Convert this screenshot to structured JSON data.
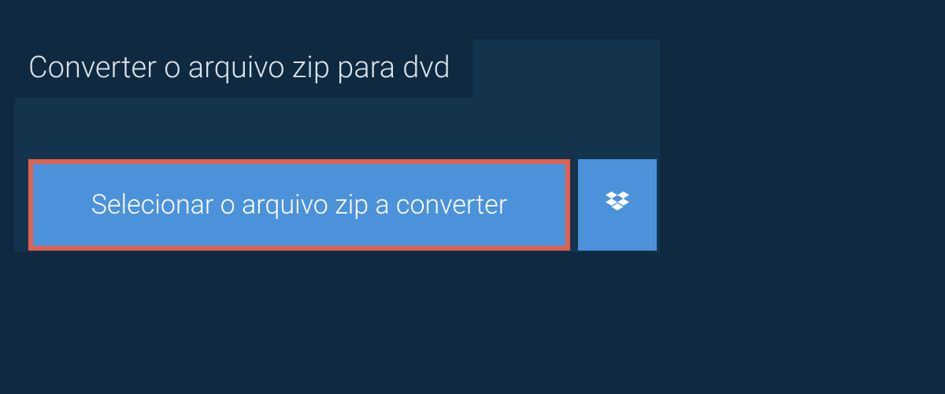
{
  "heading": "Converter o arquivo zip para dvd",
  "buttons": {
    "select_label": "Selecionar o arquivo zip a converter",
    "dropbox_icon": "dropbox-icon"
  },
  "colors": {
    "page_bg": "#0f2940",
    "panel_bg": "#14334d",
    "button_bg": "#4b92db",
    "highlight_border": "#e1614e",
    "text_light": "#d9e3ec",
    "text_white": "#ffffff"
  }
}
